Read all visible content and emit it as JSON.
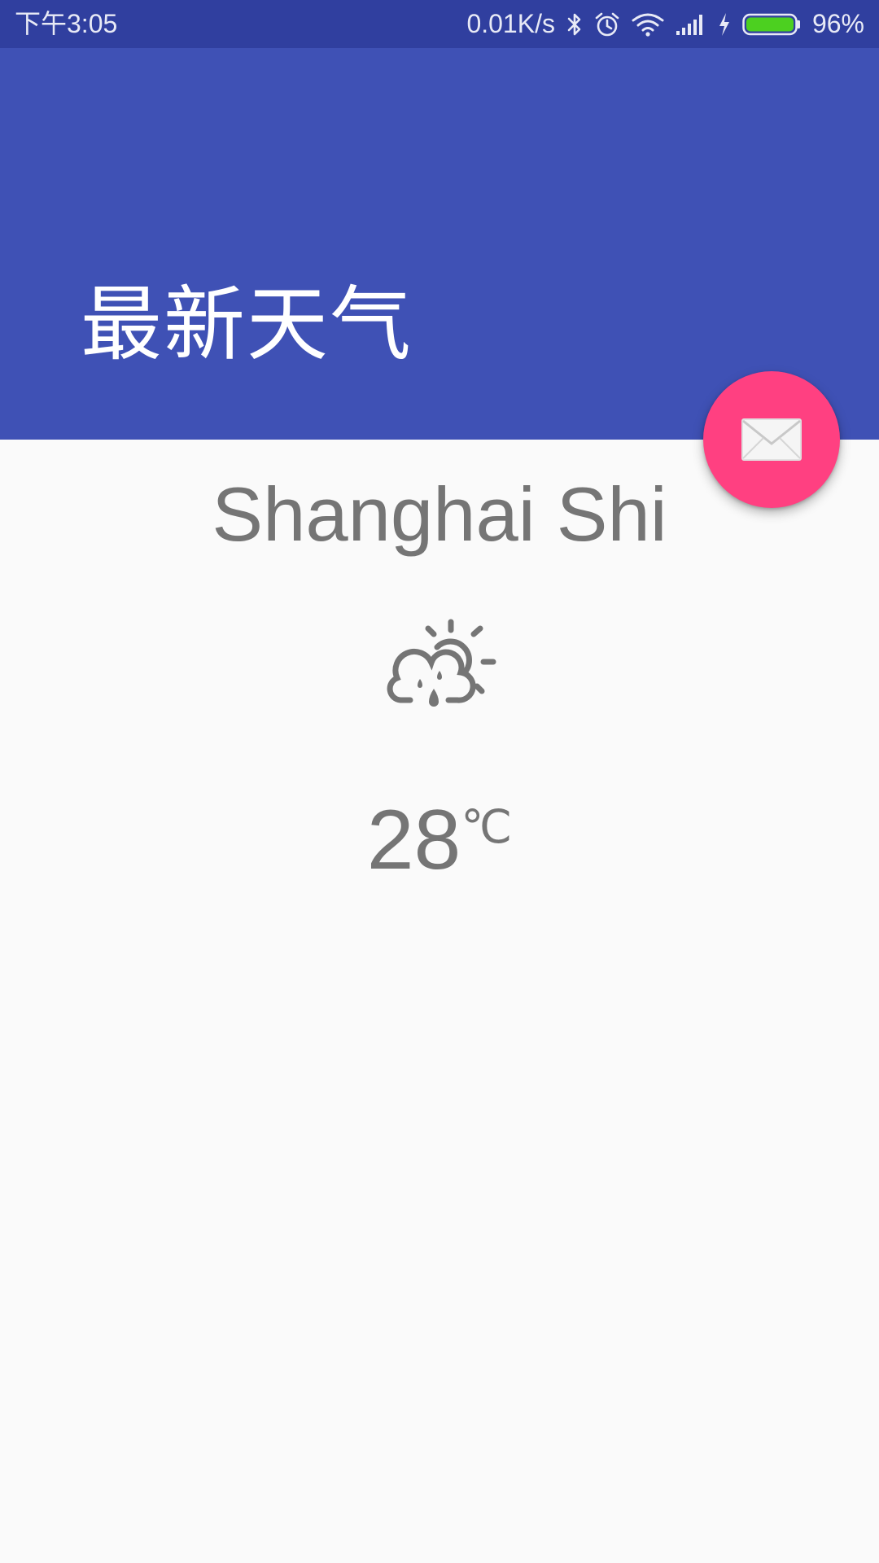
{
  "status_bar": {
    "time": "下午3:05",
    "network_speed": "0.01K/s",
    "icons": [
      "bluetooth-icon",
      "alarm-icon",
      "wifi-icon",
      "signal-icon",
      "charging-icon",
      "battery-icon"
    ],
    "battery_percent": "96%",
    "battery_level": 0.96,
    "background_color": "#303F9F"
  },
  "app_bar": {
    "title": "最新天气",
    "background_color": "#3F51B5"
  },
  "fab": {
    "icon": "mail-icon",
    "color": "#FF4081"
  },
  "weather": {
    "city": "Shanghai Shi",
    "condition_icon": "cloud-rain-sun-icon",
    "temperature": "28",
    "unit": "℃",
    "text_color": "#757575"
  }
}
